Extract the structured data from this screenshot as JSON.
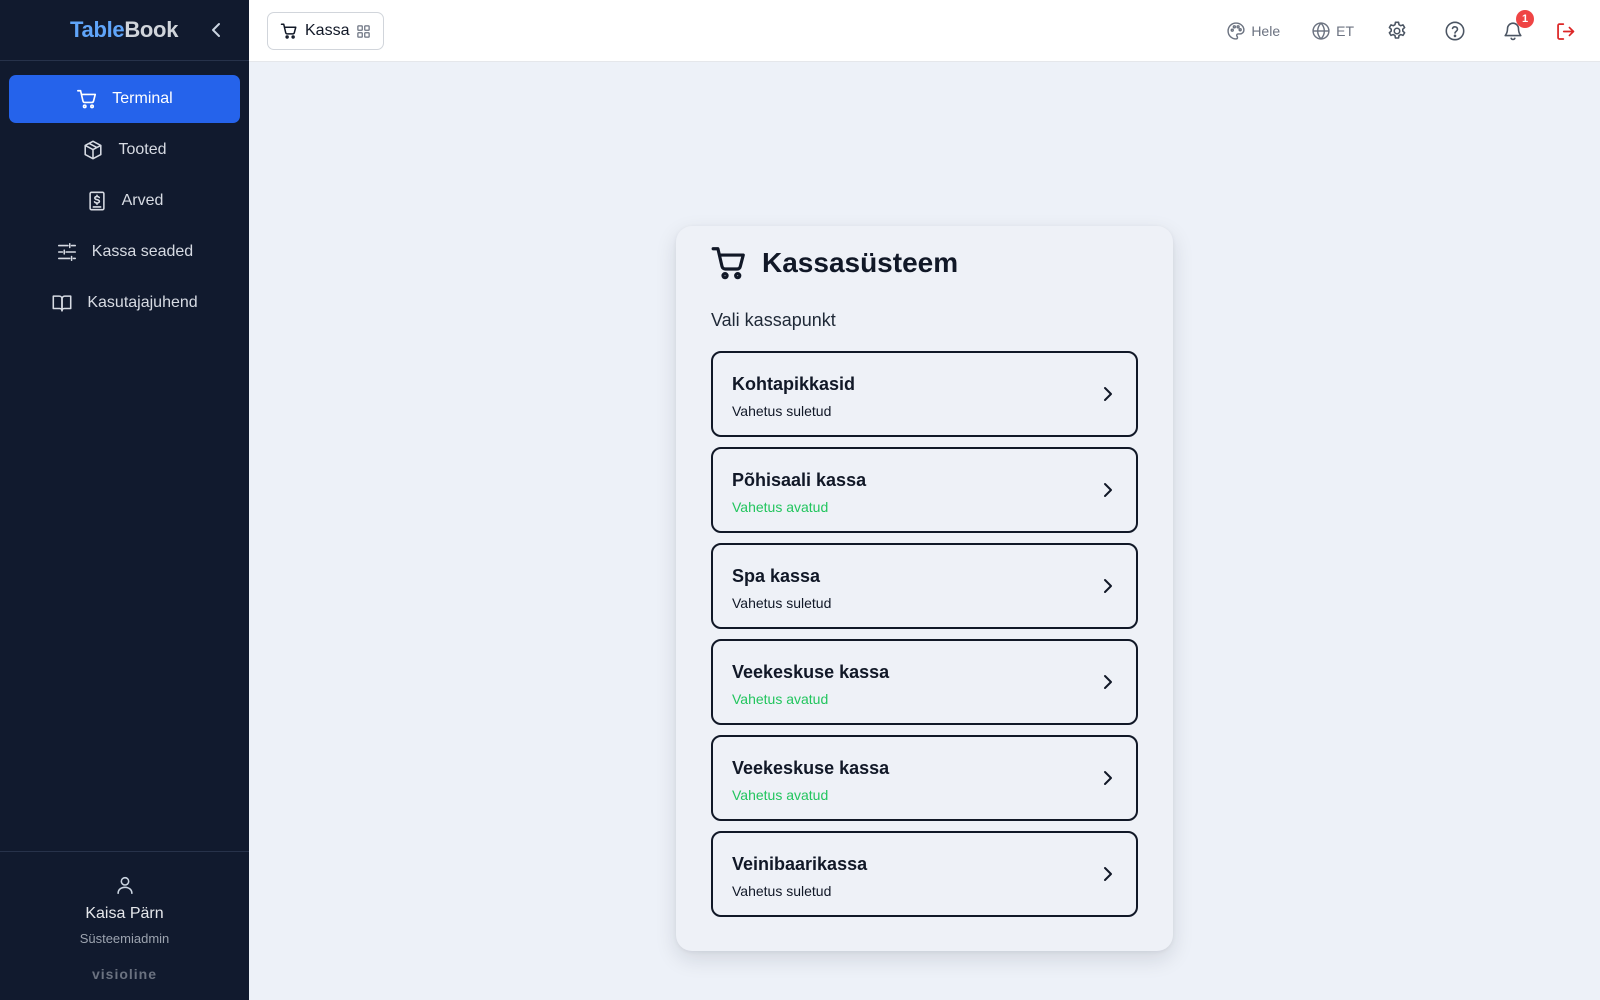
{
  "sidebar": {
    "brand_part1": "Table",
    "brand_part2": "Book",
    "items": [
      {
        "label": "Terminal",
        "icon": "cart-icon",
        "active": true
      },
      {
        "label": "Tooted",
        "icon": "box-icon",
        "active": false
      },
      {
        "label": "Arved",
        "icon": "receipt-icon",
        "active": false
      },
      {
        "label": "Kassa seaded",
        "icon": "sliders-icon",
        "active": false
      },
      {
        "label": "Kasutajajuhend",
        "icon": "book-icon",
        "active": false
      }
    ],
    "user": {
      "name": "Kaisa Pärn",
      "role": "Süsteemiadmin"
    },
    "vendor": "visioline"
  },
  "header": {
    "module_label": "Kassa",
    "theme_label": "Hele",
    "language_label": "ET",
    "notification_count": "1"
  },
  "main": {
    "title": "Kassasüsteem",
    "subtitle": "Vali kassapunkt",
    "pos_points": [
      {
        "name": "Kohtapikkasid",
        "status": "Vahetus suletud",
        "open": false
      },
      {
        "name": "Põhisaali kassa",
        "status": "Vahetus avatud",
        "open": true
      },
      {
        "name": "Spa kassa",
        "status": "Vahetus suletud",
        "open": false
      },
      {
        "name": "Veekeskuse kassa",
        "status": "Vahetus avatud",
        "open": true
      },
      {
        "name": "Veekeskuse kassa",
        "status": "Vahetus avatud",
        "open": true
      },
      {
        "name": "Veinibaarikassa",
        "status": "Vahetus suletud",
        "open": false
      }
    ]
  },
  "colors": {
    "sidebar_bg": "#111a2e",
    "accent": "#2563eb",
    "status_open": "#22c55e",
    "logout": "#dc2626",
    "badge": "#ef4444"
  }
}
